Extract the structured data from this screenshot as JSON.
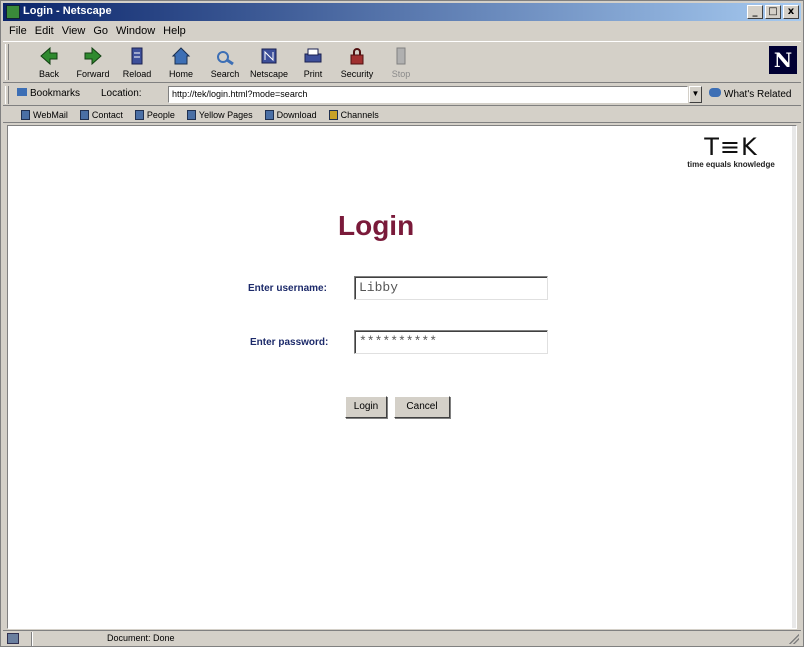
{
  "window": {
    "title": "Login - Netscape",
    "controls": [
      "_",
      "□",
      "x"
    ]
  },
  "menu": [
    "File",
    "Edit",
    "View",
    "Go",
    "Window",
    "Help"
  ],
  "toolbar": {
    "buttons": [
      {
        "label": "Back",
        "icon": "back-arrow-icon",
        "color": "#2f8a2f"
      },
      {
        "label": "Forward",
        "icon": "forward-arrow-icon",
        "color": "#2f8a2f"
      },
      {
        "label": "Reload",
        "icon": "reload-icon",
        "color": "#3d4f9a"
      },
      {
        "label": "Home",
        "icon": "home-icon",
        "color": "#3d6fb5"
      },
      {
        "label": "Search",
        "icon": "search-icon",
        "color": "#3d6fb5"
      },
      {
        "label": "Netscape",
        "icon": "netscape-icon",
        "color": "#3d4f9a"
      },
      {
        "label": "Print",
        "icon": "print-icon",
        "color": "#3d4f9a"
      },
      {
        "label": "Security",
        "icon": "lock-icon",
        "color": "#a03030"
      },
      {
        "label": "Stop",
        "icon": "stop-icon",
        "color": "#9a9a9a",
        "disabled": true
      }
    ],
    "logo": "N"
  },
  "location": {
    "bookmarks_label": "Bookmarks",
    "label": "Location:",
    "url": "http://tek/login.html?mode=search",
    "related": "What's Related"
  },
  "personal_toolbar": [
    "WebMail",
    "Contact",
    "People",
    "Yellow Pages",
    "Download",
    "Channels"
  ],
  "page": {
    "logo_mark": "T≡K",
    "logo_tag": "time equals knowledge",
    "heading": "Login",
    "username_label": "Enter username:",
    "username_value": "Libby",
    "password_label": "Enter password:",
    "password_value": "**********",
    "login_button": "Login",
    "cancel_button": "Cancel"
  },
  "status": {
    "text": "Document: Done"
  }
}
